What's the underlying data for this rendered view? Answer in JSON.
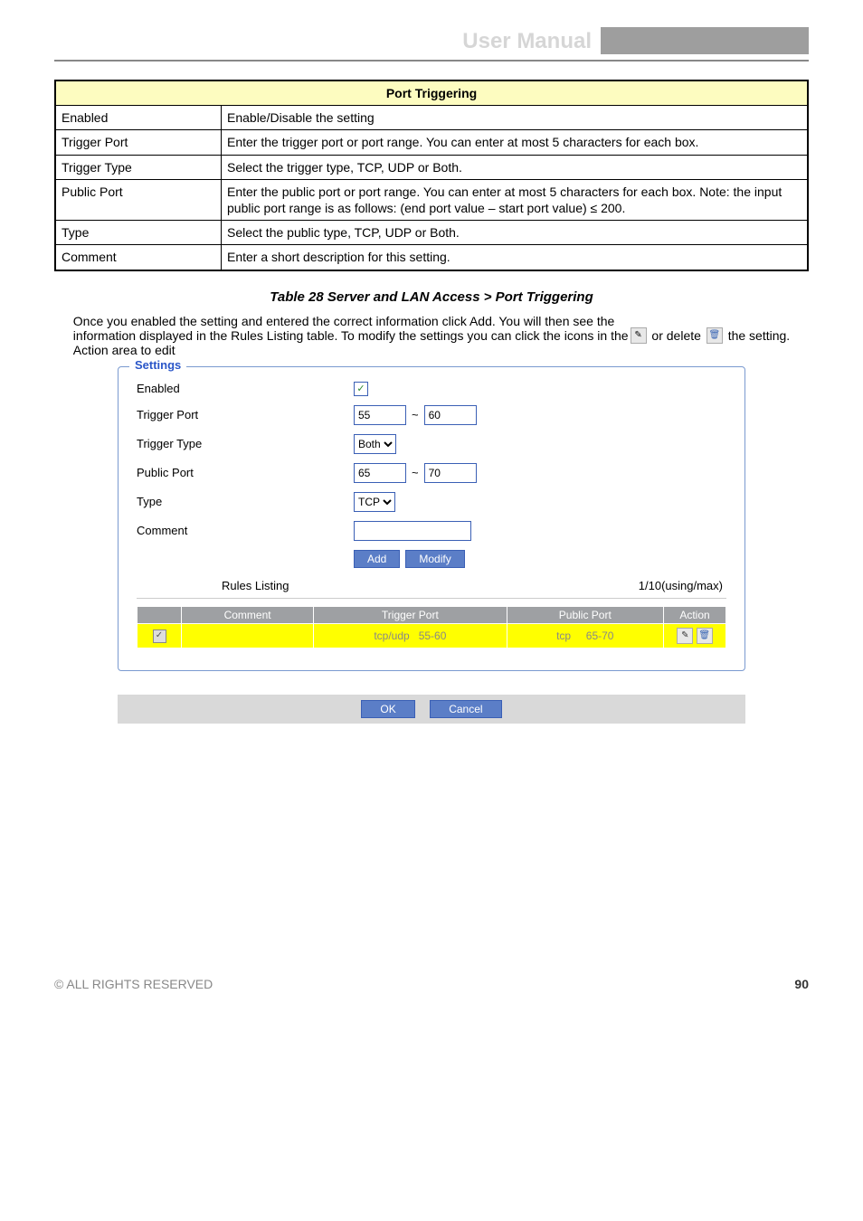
{
  "header": {
    "user_manual": "User Manual"
  },
  "defs": {
    "title": "Port Triggering",
    "rows": [
      {
        "label": "Enabled",
        "desc": "Enable/Disable the setting"
      },
      {
        "label": "Trigger Port",
        "desc": "Enter the trigger port or port range. You can enter at most 5 characters for each box."
      },
      {
        "label": "Trigger Type",
        "desc": "Select the trigger type, TCP, UDP or Both."
      },
      {
        "label": "Public Port",
        "desc": "Enter the public port or port range. You can enter at most 5 characters for each box. Note: the input public port range is as follows: (end port value – start port value) ≤ 200."
      },
      {
        "label": "Type",
        "desc": "Select the public type, TCP, UDP or Both."
      },
      {
        "label": "Comment",
        "desc": "Enter a short description for this setting."
      }
    ]
  },
  "table_caption": "Table 28 Server and LAN Access > Port Triggering",
  "edit_note_pre": " or delete ",
  "edit_note_post": " the setting.",
  "edit_note_lead": "Once you enabled the setting and entered the correct information click Add. You will then see the\ninformation displayed in the Rules Listing table. To modify the settings you can click the icons in the\nAction area to edit ",
  "form": {
    "legend": "Settings",
    "enabled_label": "Enabled",
    "enabled_checked": "✓",
    "trigger_port_label": "Trigger Port",
    "trigger_port_from": "55",
    "trigger_port_to": "60",
    "tilde": "~",
    "trigger_type_label": "Trigger Type",
    "trigger_type_value": "Both",
    "public_port_label": "Public Port",
    "public_port_from": "65",
    "public_port_to": "70",
    "type_label": "Type",
    "type_value": "TCP",
    "comment_label": "Comment",
    "comment_value": "",
    "add_label": "Add",
    "modify_label": "Modify",
    "rules_listing_label": "Rules Listing",
    "rules_count": "1/10(using/max)",
    "columns": {
      "c0": "",
      "c1": "Comment",
      "c2": "Trigger Port",
      "c3": "Public Port",
      "c4": "Action"
    },
    "row": {
      "enabled": "✓",
      "comment": "",
      "trigger_proto": "tcp/udp",
      "trigger_range": "55-60",
      "public_proto": "tcp",
      "public_range": "65-70"
    },
    "ok_label": "OK",
    "cancel_label": "Cancel"
  },
  "footer": {
    "manual": "© ALL RIGHTS RESERVED",
    "pageno": "90"
  }
}
